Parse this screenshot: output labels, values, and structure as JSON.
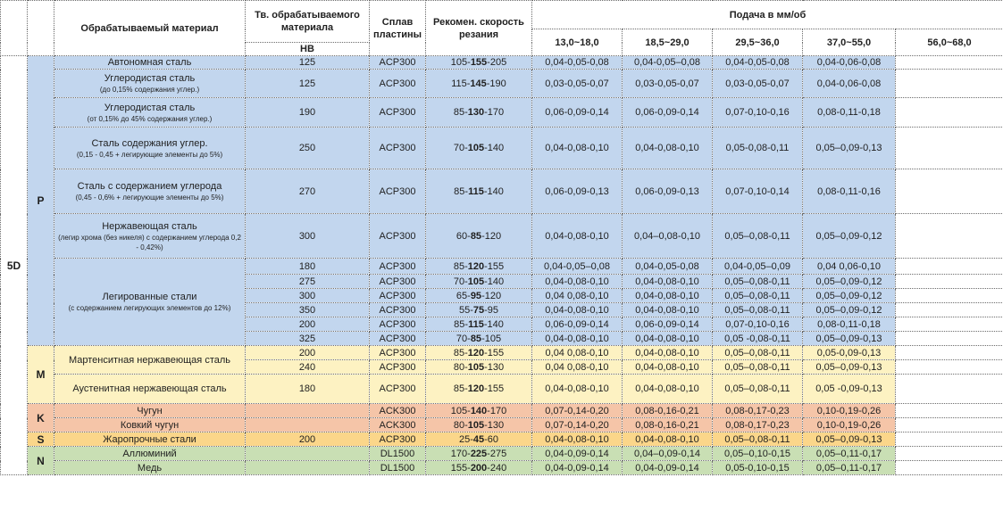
{
  "header": {
    "material": "Обрабатываемый материал",
    "hardness": "Тв. обрабатываемого материала",
    "hardness_unit": "НВ",
    "alloy": "Сплав пластины",
    "speed": "Рекомен. скорость резания",
    "feed": "Подача в мм/об",
    "ranges": [
      "13,0~18,0",
      "18,5~29,0",
      "29,5~36,0",
      "37,0~55,0",
      "56,0~68,0"
    ]
  },
  "section_label": "5D",
  "groups": {
    "P": "P",
    "M": "M",
    "K": "K",
    "S": "S",
    "N": "N"
  },
  "materials": {
    "auto": {
      "name": "Автономная сталь"
    },
    "carbon1": {
      "name": "Углеродистая сталь",
      "note": "(до 0,15% содержания углер.)"
    },
    "carbon2": {
      "name": "Углеродистая сталь",
      "note": "(от 0,15% до 45% содержания углер.)"
    },
    "carbon3": {
      "name": "Сталь содержания углер.",
      "note": "(0,15 - 0,45 + легирующие элементы до 5%)"
    },
    "carbon4": {
      "name": "Сталь с содержанием углерода",
      "note": "(0,45 - 0,6% + легирующие элементы до 5%)"
    },
    "stainless": {
      "name": "Нержавеющая сталь",
      "note": "(легир хрома (без никеля) с содержанием углерода 0,2 - 0,42%)"
    },
    "alloyed": {
      "name": "Легированные стали",
      "note": "(с содержанием легирующих элементов до 12%)"
    },
    "martensite": {
      "name": "Мартенситная нержавеющая сталь"
    },
    "austenite": {
      "name": "Аустенитная нержавеющая сталь"
    },
    "castiron": {
      "name": "Чугун"
    },
    "malleable": {
      "name": "Ковкий чугун"
    },
    "heatres": {
      "name": "Жаропрочные стали"
    },
    "aluminium": {
      "name": "Аллюминий"
    },
    "copper": {
      "name": "Медь"
    }
  },
  "rows": [
    {
      "hb": "125",
      "alloy": "ACP300",
      "s1": "105-",
      "s2": "155",
      "s3": "-205",
      "f": [
        "0,04-0,05-0,08",
        "0,04-0,05–0,08",
        "0,04-0,05-0,08",
        "0,04-0,06-0,08",
        ""
      ]
    },
    {
      "hb": "125",
      "alloy": "ACP300",
      "s1": "115-",
      "s2": "145",
      "s3": "-190",
      "f": [
        "0,03-0,05-0,07",
        "0,03-0,05-0,07",
        "0,03-0,05-0,07",
        "0,04-0,06-0,08",
        ""
      ]
    },
    {
      "hb": "190",
      "alloy": "ACP300",
      "s1": "85-",
      "s2": "130",
      "s3": "-170",
      "f": [
        "0,06-0,09-0,14",
        "0,06-0,09-0,14",
        "0,07-0,10-0,16",
        "0,08-0,11-0,18",
        ""
      ]
    },
    {
      "hb": "250",
      "alloy": "ACP300",
      "s1": "70-",
      "s2": "105",
      "s3": "-140",
      "f": [
        "0,04-0,08-0,10",
        "0,04-0,08-0,10",
        "0,05-0,08-0,11",
        "0,05–0,09-0,13",
        ""
      ]
    },
    {
      "hb": "270",
      "alloy": "ACP300",
      "s1": "85-",
      "s2": "115",
      "s3": "-140",
      "f": [
        "0,06-0,09-0,13",
        "0,06-0,09-0,13",
        "0,07-0,10-0,14",
        "0,08-0,11-0,16",
        ""
      ]
    },
    {
      "hb": "300",
      "alloy": "ACP300",
      "s1": "60-",
      "s2": "85",
      "s3": "-120",
      "f": [
        "0,04-0,08-0,10",
        "0,04–0,08-0,10",
        "0,05–0,08-0,11",
        "0,05–0,09-0,12",
        ""
      ]
    },
    {
      "hb": "180",
      "alloy": "ACP300",
      "s1": "85-",
      "s2": "120",
      "s3": "-155",
      "f": [
        "0,04-0,05–0,08",
        "0,04-0,05-0,08",
        "0,04-0,05–0,09",
        "0,04 0,06-0,10",
        ""
      ]
    },
    {
      "hb": "275",
      "alloy": "ACP300",
      "s1": "70-",
      "s2": "105",
      "s3": "-140",
      "f": [
        "0,04-0,08-0,10",
        "0,04-0,08-0,10",
        "0,05–0,08-0,11",
        "0,05–0,09-0,12",
        ""
      ]
    },
    {
      "hb": "300",
      "alloy": "ACP300",
      "s1": "65-",
      "s2": "95",
      "s3": "-120",
      "f": [
        "0,04 0,08-0,10",
        "0,04-0,08-0,10",
        "0,05–0,08-0,11",
        "0,05–0,09-0,12",
        ""
      ]
    },
    {
      "hb": "350",
      "alloy": "ACP300",
      "s1": "55-",
      "s2": "75",
      "s3": "-95",
      "f": [
        "0,04-0,08-0,10",
        "0,04-0,08-0,10",
        "0,05–0,08-0,11",
        "0,05–0,09-0,12",
        ""
      ]
    },
    {
      "hb": "200",
      "alloy": "ACP300",
      "s1": "85-",
      "s2": "115",
      "s3": "-140",
      "f": [
        "0,06-0,09-0,14",
        "0,06-0,09-0,14",
        "0,07-0,10-0,16",
        "0,08-0,11-0,18",
        ""
      ]
    },
    {
      "hb": "325",
      "alloy": "ACP300",
      "s1": "70-",
      "s2": "85",
      "s3": "-105",
      "f": [
        "0,04-0,08-0,10",
        "0,04-0,08-0,10",
        "0,05 -0,08-0,11",
        "0,05–0,09-0,13",
        ""
      ]
    },
    {
      "hb": "200",
      "alloy": "ACP300",
      "s1": "85-",
      "s2": "120",
      "s3": "-155",
      "f": [
        "0,04 0,08-0,10",
        "0,04-0,08-0,10",
        "0,05–0,08-0,11",
        "0,05-0,09-0,13",
        ""
      ]
    },
    {
      "hb": "240",
      "alloy": "ACP300",
      "s1": "80-",
      "s2": "105",
      "s3": "-130",
      "f": [
        "0,04 0,08-0,10",
        "0,04-0,08-0,10",
        "0,05–0,08-0,11",
        "0,05–0,09-0,13",
        ""
      ]
    },
    {
      "hb": "180",
      "alloy": "ACP300",
      "s1": "85-",
      "s2": "120",
      "s3": "-155",
      "f": [
        "0,04-0,08-0,10",
        "0,04-0,08-0,10",
        "0,05–0,08-0,11",
        "0,05 -0,09-0,13",
        ""
      ]
    },
    {
      "hb": "",
      "alloy": "ACK300",
      "s1": "105-",
      "s2": "140",
      "s3": "-170",
      "f": [
        "0,07-0,14-0,20",
        "0,08-0,16-0,21",
        "0,08-0,17-0,23",
        "0,10-0,19-0,26",
        ""
      ]
    },
    {
      "hb": "",
      "alloy": "ACK300",
      "s1": "80-",
      "s2": "105",
      "s3": "-130",
      "f": [
        "0,07-0,14-0,20",
        "0,08-0,16-0,21",
        "0,08-0,17-0,23",
        "0,10-0,19-0,26",
        ""
      ]
    },
    {
      "hb": "200",
      "alloy": "ACP300",
      "s1": "25-",
      "s2": "45",
      "s3": "-60",
      "f": [
        "0,04-0,08-0,10",
        "0,04-0,08-0,10",
        "0,05–0,08-0,11",
        "0,05–0,09-0,13",
        ""
      ]
    },
    {
      "hb": "",
      "alloy": "DL1500",
      "s1": "170-",
      "s2": "225",
      "s3": "-275",
      "f": [
        "0,04-0,09-0,14",
        "0,04–0,09-0,14",
        "0,05–0,10-0,15",
        "0,05–0,11-0,17",
        ""
      ]
    },
    {
      "hb": "",
      "alloy": "DL1500",
      "s1": "155-",
      "s2": "200",
      "s3": "-240",
      "f": [
        "0,04-0,09-0,14",
        "0,04-0,09-0,14",
        "0,05-0,10-0,15",
        "0,05–0,11-0,17",
        ""
      ]
    }
  ]
}
